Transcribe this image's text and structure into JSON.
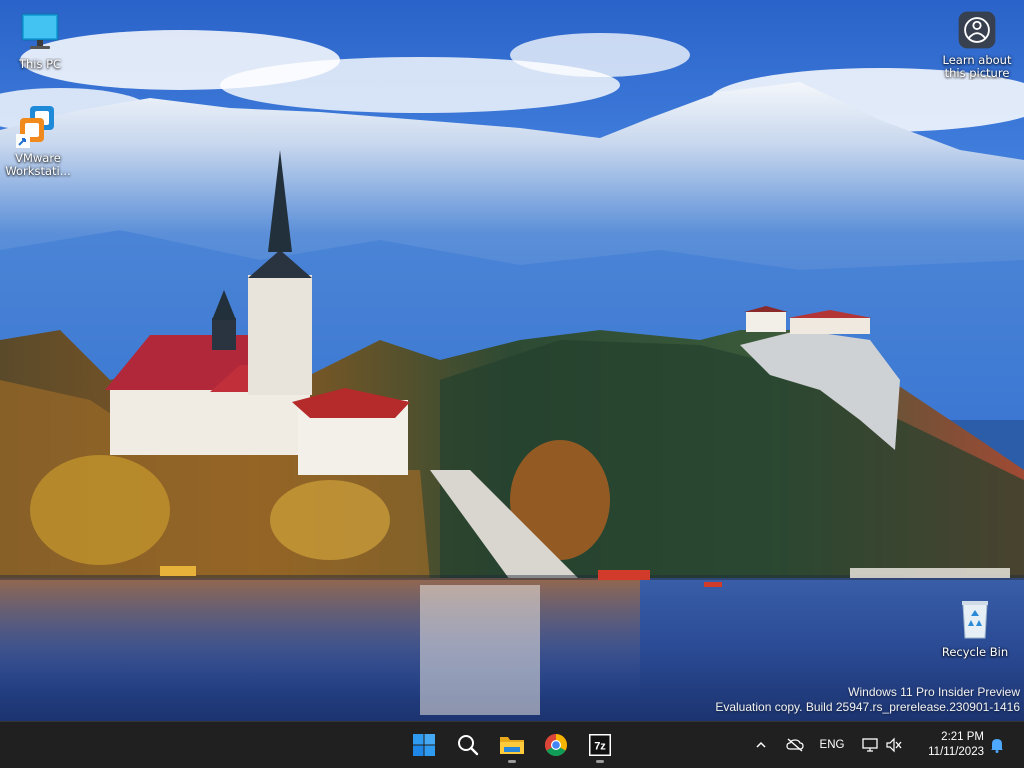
{
  "desktop": {
    "icons": [
      {
        "label": "This PC"
      },
      {
        "label": "VMware Workstati..."
      },
      {
        "label": "Learn about this picture"
      },
      {
        "label": "Recycle Bin"
      }
    ],
    "watermark": {
      "line1": "Windows 11 Pro Insider Preview",
      "line2": "Evaluation copy. Build 25947.rs_prerelease.230901-1416"
    }
  },
  "taskbar": {
    "apps": [
      {
        "icon": "windows-start-icon"
      },
      {
        "icon": "search-icon"
      },
      {
        "icon": "file-explorer-icon"
      },
      {
        "icon": "chrome-icon"
      },
      {
        "icon": "7zip-icon",
        "label": "7z"
      }
    ],
    "tray": {
      "language": "ENG",
      "time": "2:21 PM",
      "date": "11/11/2023"
    }
  },
  "colors": {
    "taskbar_bg": "#202020",
    "accent_blue": "#0078d4"
  }
}
